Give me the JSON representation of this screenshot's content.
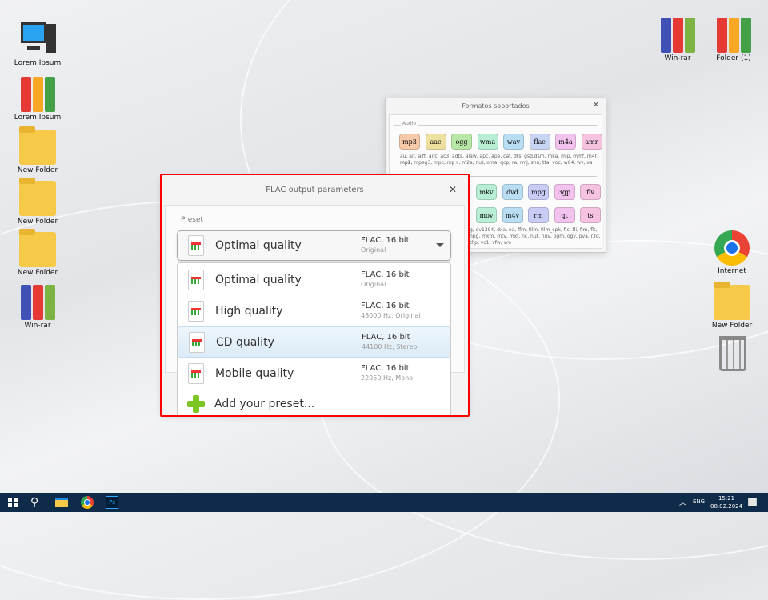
{
  "desktop": {
    "left_icons": [
      "Lorem Ipsum",
      "Lorem Ipsum",
      "New Folder",
      "New Folder",
      "New Folder",
      "Win-rar"
    ],
    "top_right_icons": [
      "Win-rar",
      "Folder (1)"
    ],
    "right_icons": [
      "Internet",
      "New Folder"
    ]
  },
  "formats_window": {
    "title": "Formatos soportados",
    "audio_label": "Audio",
    "audio_formats": [
      "mp3",
      "aac",
      "ogg",
      "wma",
      "wav",
      "flac",
      "m4a",
      "amr"
    ],
    "audio_list_1": "au, aif, aiff, aifc, ac3, adts, alaw, apc, ape, caf, dts, gsd,dsm, mka, mlp, mmf, m4r, mp1,",
    "audio_list_2": "mp2, mpeg3, mpc, mp+, m2a, nut, oma, qcp, ra, rmj, shn, tta, voc, w64, wv, xa",
    "video_formats_row1": [
      "mkv",
      "dvd",
      "mpg",
      "3gp",
      "flv"
    ],
    "video_formats_row2": [
      "mov",
      "m4v",
      "rm",
      "qt",
      "ts"
    ],
    "video_list_1": "g, dv1394, dxa, ea, ffm, film, film_cpk, flc, fli, flm, flt,",
    "video_list_2": "npg, mkm, mtv, mxf, nc, nut, nuv, ogm, ogv, pva, r3d,",
    "video_list_3": "thp, vc1, vfw, vro"
  },
  "flac_dialog": {
    "title": "FLAC output parameters",
    "preset_label": "Preset",
    "selected": {
      "name": "Optimal quality",
      "format": "FLAC, 16 bit",
      "detail": "Original"
    },
    "options": [
      {
        "name": "Optimal quality",
        "format": "FLAC, 16 bit",
        "detail": "Original"
      },
      {
        "name": "High quality",
        "format": "FLAC, 16 bit",
        "detail": "48000 Hz,  Original"
      },
      {
        "name": "CD quality",
        "format": "FLAC, 16 bit",
        "detail": "44100 Hz,  Stereo"
      },
      {
        "name": "Mobile quality",
        "format": "FLAC, 16 bit",
        "detail": "22050 Hz,  Mono"
      }
    ],
    "add_preset": "Add your preset..."
  },
  "taskbar": {
    "lang": "ENG",
    "time": "15:21",
    "date": "08.02.2024"
  },
  "colors": {
    "highlight": "#e0eef9",
    "taskbar": "#0f2b4a",
    "annotation": "#ff0000"
  }
}
